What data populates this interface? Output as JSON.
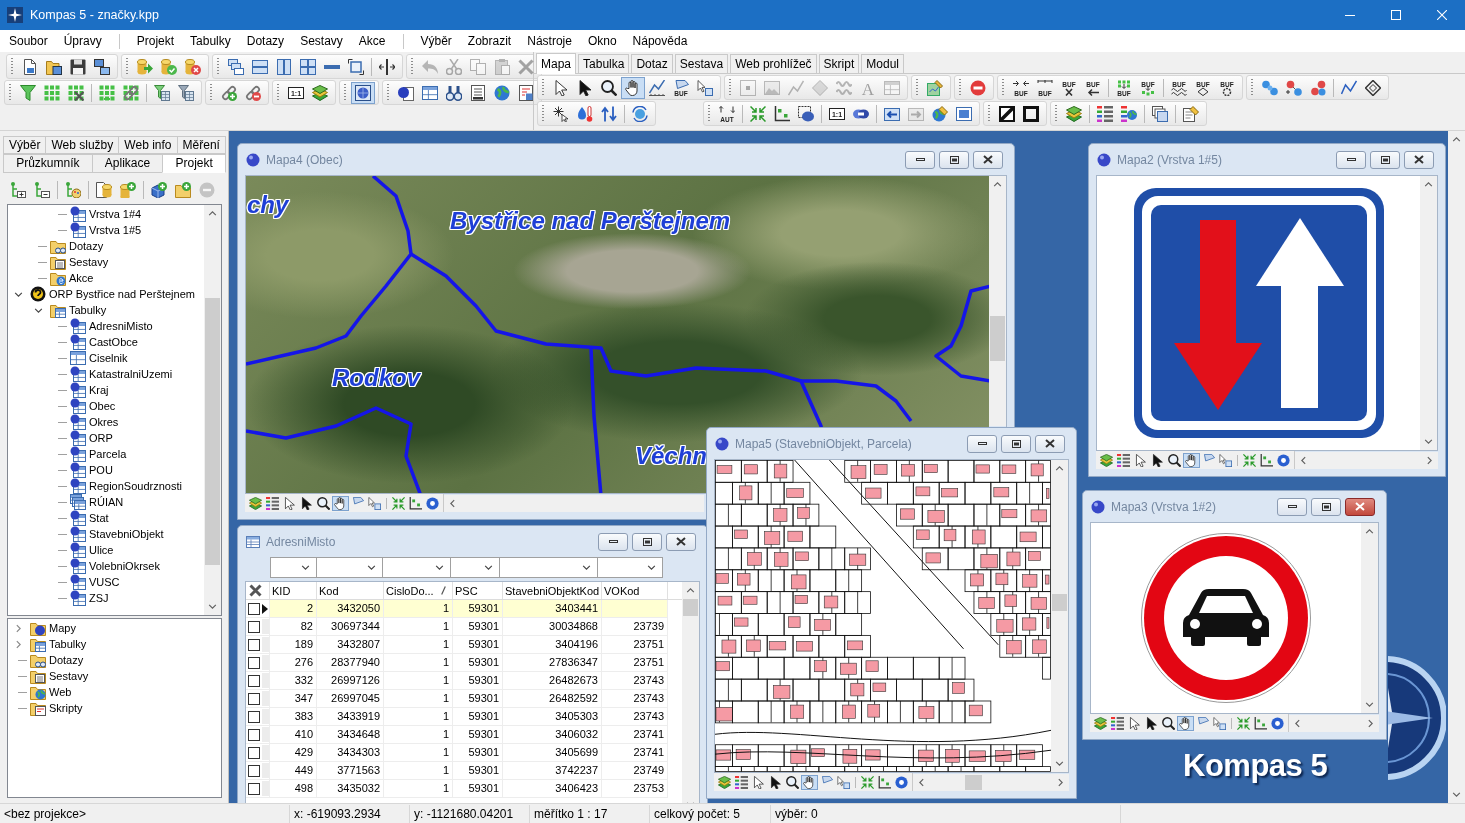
{
  "window": {
    "title": "Kompas 5 - značky.kpp"
  },
  "menu_groups": [
    {
      "items": [
        "Soubor",
        "Úpravy"
      ]
    },
    {
      "items": [
        "Projekt",
        "Tabulky",
        "Dotazy",
        "Sestavy",
        "Akce"
      ]
    },
    {
      "items": [
        "Výběr",
        "Zobrazit",
        "Nástroje",
        "Okno",
        "Nápověda"
      ]
    }
  ],
  "toolbar": {
    "edit_disabled": true,
    "map_view_pressed": true,
    "icon_captions": [
      "1:1"
    ]
  },
  "command_bar": {
    "tabs": [
      {
        "label": "Mapa",
        "selected": true
      },
      {
        "label": "Tabulka",
        "selected": false
      },
      {
        "label": "Dotaz",
        "selected": false
      },
      {
        "label": "Sestava",
        "selected": false
      },
      {
        "label": "Web prohlížeč",
        "selected": false
      },
      {
        "label": "Skript",
        "selected": false
      },
      {
        "label": "Modul",
        "selected": false
      }
    ],
    "pan_pressed": true,
    "draw_disabled": true,
    "forward_disabled": true,
    "icon_captions": [
      "BUF",
      "A",
      "BUF",
      "BUF",
      "BUF",
      "BUF",
      "BUF",
      "BUF",
      "BUF",
      "BUF",
      "BUF",
      "AUT",
      "1:1"
    ]
  },
  "side_panel": {
    "tab_rows": [
      {
        "tabs": [
          {
            "label": "Výběr",
            "selected": false
          },
          {
            "label": "Web služby",
            "selected": false
          },
          {
            "label": "Web info",
            "selected": false
          },
          {
            "label": "Měření",
            "selected": false
          }
        ]
      },
      {
        "tabs": [
          {
            "label": "Průzkumník",
            "selected": false
          },
          {
            "label": "Aplikace",
            "selected": false
          },
          {
            "label": "Projekt",
            "selected": true
          }
        ]
      }
    ],
    "remove_disabled": true,
    "project_tree": {
      "items": [
        {
          "children": [
            {
              "children": [
                {
                  "label": "Vrstva 1#4",
                  "kind": "layer"
                },
                {
                  "label": "Vrstva 1#5",
                  "kind": "layer"
                }
              ]
            },
            {
              "label": "Dotazy",
              "kind": "queries"
            },
            {
              "label": "Sestavy",
              "kind": "reports"
            },
            {
              "label": "Akce",
              "kind": "actions"
            }
          ]
        },
        {
          "label": "ORP Bystřice nad Perštejnem",
          "kind": "project",
          "expanded": true,
          "children": [
            {
              "label": "Tabulky",
              "kind": "tables",
              "expanded": true,
              "children": [
                {
                  "label": "AdresniMisto",
                  "kind": "layer"
                },
                {
                  "label": "CastObce",
                  "kind": "layer"
                },
                {
                  "label": "Ciselnik",
                  "kind": "table"
                },
                {
                  "label": "KatastralniUzemi",
                  "kind": "layer"
                },
                {
                  "label": "Kraj",
                  "kind": "layer"
                },
                {
                  "label": "Obec",
                  "kind": "layer"
                },
                {
                  "label": "Okres",
                  "kind": "layer"
                },
                {
                  "label": "ORP",
                  "kind": "layer"
                },
                {
                  "label": "Parcela",
                  "kind": "layer"
                },
                {
                  "label": "POU",
                  "kind": "layer"
                },
                {
                  "label": "RegionSoudrznosti",
                  "kind": "layer"
                },
                {
                  "label": "RÚIAN",
                  "kind": "table-set"
                },
                {
                  "label": "Stat",
                  "kind": "layer"
                },
                {
                  "label": "StavebniObjekt",
                  "kind": "layer"
                },
                {
                  "label": "Ulice",
                  "kind": "layer"
                },
                {
                  "label": "VolebniOkrsek",
                  "kind": "layer"
                },
                {
                  "label": "VUSC",
                  "kind": "layer"
                },
                {
                  "label": "ZSJ",
                  "kind": "layer"
                }
              ]
            }
          ]
        }
      ]
    },
    "overview_tree": {
      "items": [
        {
          "label": "Mapy",
          "kind": "maps",
          "expanded": false
        },
        {
          "label": "Tabulky",
          "kind": "tables",
          "expanded": false
        },
        {
          "label": "Dotazy",
          "kind": "queries"
        },
        {
          "label": "Sestavy",
          "kind": "reports"
        },
        {
          "label": "Web",
          "kind": "web"
        },
        {
          "label": "Skripty",
          "kind": "scripts"
        }
      ]
    }
  },
  "map_windows": [
    {
      "title": "Mapa4 (Obec)",
      "kind": "satellite",
      "active": false,
      "pan_on": true,
      "labels": [
        "chy",
        "Bystřice nad Perštejnem",
        "Rodkov",
        "Věchn"
      ]
    },
    {
      "title": "Mapa2 (Vrstva 1#5)",
      "kind": "priority-sign",
      "active": false,
      "pan_on": true
    },
    {
      "title": "Mapa5 (StavebniObjekt, Parcela)",
      "kind": "cadastral",
      "active": false,
      "pan_on": true
    },
    {
      "title": "Mapa3 (Vrstva 1#2)",
      "kind": "no-cars-sign",
      "active": true,
      "pan_on": true
    }
  ],
  "table_window": {
    "title": "AdresniMisto",
    "columns": [
      {
        "label": "KID",
        "sorted": false
      },
      {
        "label": "Kod",
        "sorted": false
      },
      {
        "label": "CisloDo...",
        "sorted": true
      },
      {
        "label": "PSC",
        "sorted": false
      },
      {
        "label": "StavebniObjektKod",
        "sorted": false
      },
      {
        "label": "VOKod",
        "sorted": false
      }
    ],
    "rows": [
      {
        "selected": true,
        "checked": false,
        "cells": [
          "2",
          "3432050",
          "1",
          "59301",
          "3403441"
        ]
      },
      {
        "selected": false,
        "checked": false,
        "cells": [
          "82",
          "30697344",
          "1",
          "59301",
          "30034868",
          "23739"
        ]
      },
      {
        "selected": false,
        "checked": false,
        "cells": [
          "189",
          "3432807",
          "1",
          "59301",
          "3404196",
          "23751"
        ]
      },
      {
        "selected": false,
        "checked": false,
        "cells": [
          "276",
          "28377940",
          "1",
          "59301",
          "27836347",
          "23751"
        ]
      },
      {
        "selected": false,
        "checked": false,
        "cells": [
          "332",
          "26997126",
          "1",
          "59301",
          "26482673",
          "23743"
        ]
      },
      {
        "selected": false,
        "checked": false,
        "cells": [
          "347",
          "26997045",
          "1",
          "59301",
          "26482592",
          "23743"
        ]
      },
      {
        "selected": false,
        "checked": false,
        "cells": [
          "383",
          "3433919",
          "1",
          "59301",
          "3405303",
          "23743"
        ]
      },
      {
        "selected": false,
        "checked": false,
        "cells": [
          "410",
          "3434648",
          "1",
          "59301",
          "3406032",
          "23741"
        ]
      },
      {
        "selected": false,
        "checked": false,
        "cells": [
          "429",
          "3434303",
          "1",
          "59301",
          "3405699",
          "23741"
        ]
      },
      {
        "selected": false,
        "checked": false,
        "cells": [
          "449",
          "3771563",
          "1",
          "59301",
          "3742237",
          "23749"
        ]
      },
      {
        "selected": false,
        "checked": false,
        "cells": [
          "498",
          "3435032",
          "1",
          "59301",
          "3406423",
          "23753"
        ]
      }
    ]
  },
  "logo": {
    "text": "Kompas 5"
  },
  "status_bar": {
    "fields": [
      "<bez projekce>",
      "x: -619093.2934",
      "y: -1121680.04201",
      "měřítko 1 : 17",
      "celkový počet: 5",
      "výběr: 0"
    ]
  }
}
